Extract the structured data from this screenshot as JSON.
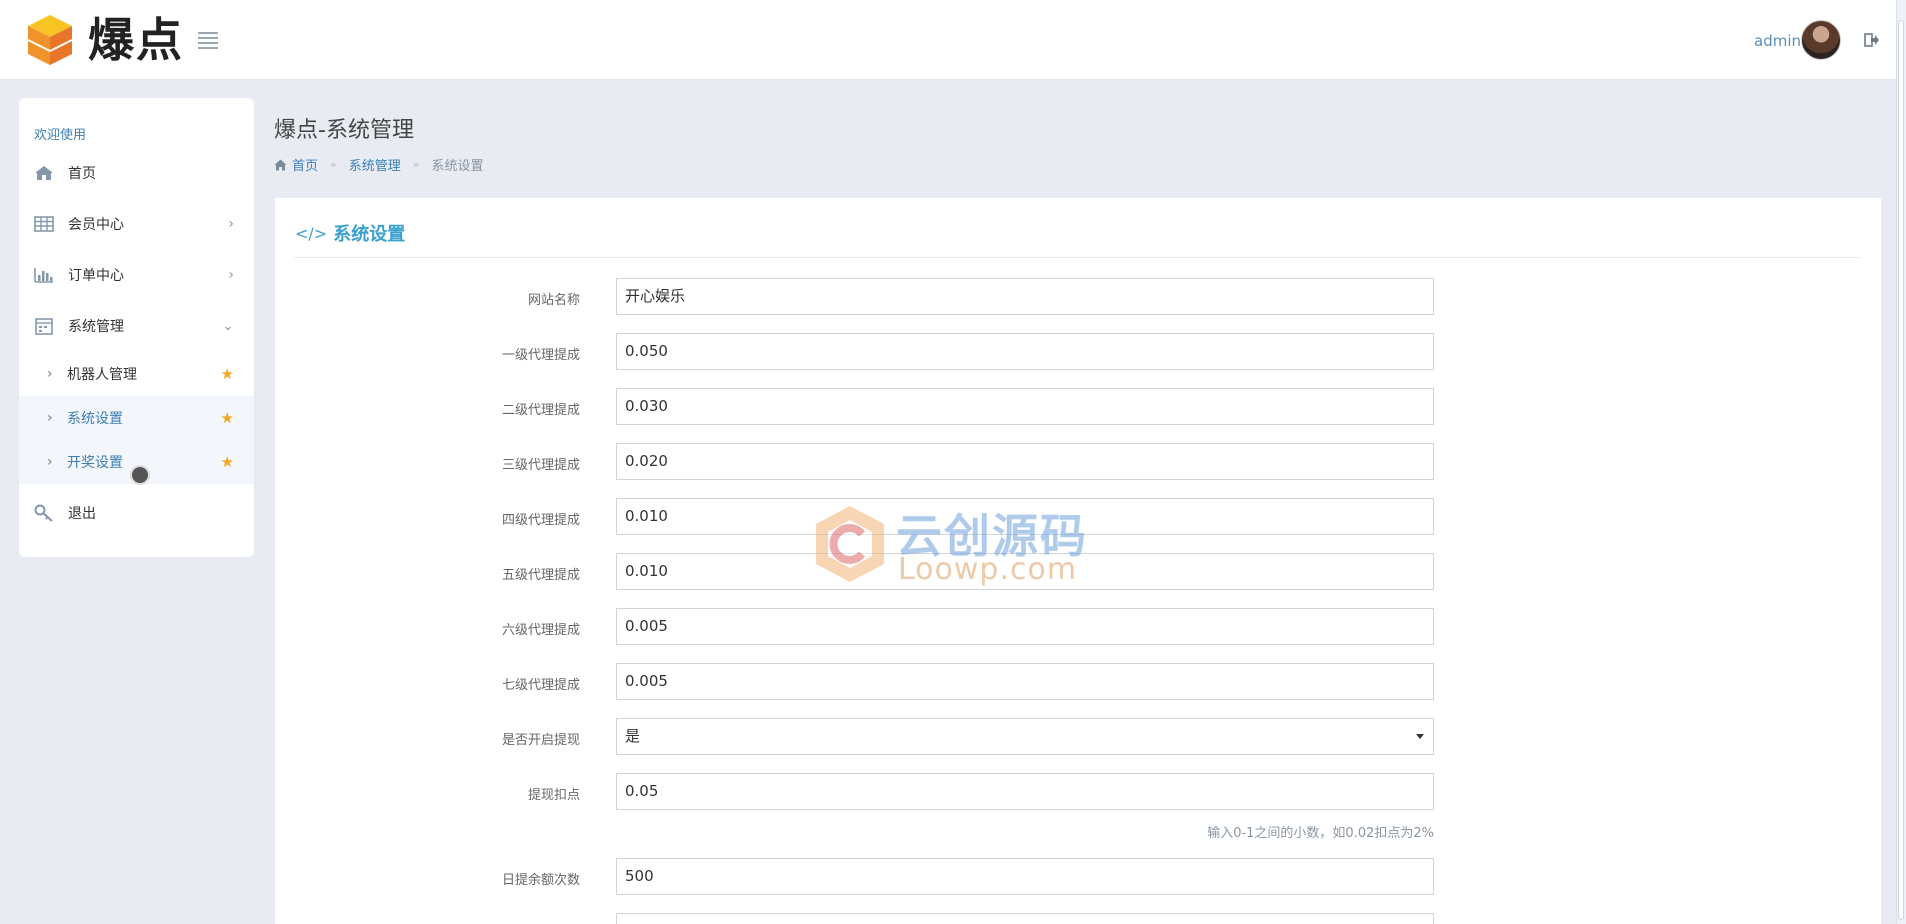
{
  "header": {
    "brand": "爆点",
    "user_name": "admin",
    "icons": {
      "logo": "cube-logo-icon",
      "menu": "list-icon",
      "logout": "logout-icon"
    }
  },
  "sidebar": {
    "welcome": "欢迎使用",
    "items": [
      {
        "label": "首页",
        "icon": "home-icon"
      },
      {
        "label": "会员中心",
        "icon": "table-icon",
        "chevron": "›"
      },
      {
        "label": "订单中心",
        "icon": "bar-chart-icon",
        "chevron": "›"
      },
      {
        "label": "系统管理",
        "icon": "calendar-icon",
        "chevron": "⌄"
      },
      {
        "label": "退出",
        "icon": "key-icon"
      }
    ],
    "subitems": [
      {
        "label": "机器人管理",
        "arrow": "›",
        "star": "★"
      },
      {
        "label": "系统设置",
        "arrow": "›",
        "star": "★"
      },
      {
        "label": "开奖设置",
        "arrow": "›",
        "star": "★"
      }
    ]
  },
  "page": {
    "title": "爆点-系统管理",
    "breadcrumb": {
      "home": "首页",
      "section": "系统管理",
      "current": "系统设置",
      "sep": "»"
    }
  },
  "panel": {
    "title": "系统设置",
    "title_icon": "</>"
  },
  "form": {
    "site_name": {
      "label": "网站名称",
      "value": "开心娱乐"
    },
    "level1": {
      "label": "一级代理提成",
      "value": "0.050"
    },
    "level2": {
      "label": "二级代理提成",
      "value": "0.030"
    },
    "level3": {
      "label": "三级代理提成",
      "value": "0.020"
    },
    "level4": {
      "label": "四级代理提成",
      "value": "0.010"
    },
    "level5": {
      "label": "五级代理提成",
      "value": "0.010"
    },
    "level6": {
      "label": "六级代理提成",
      "value": "0.005"
    },
    "level7": {
      "label": "七级代理提成",
      "value": "0.005"
    },
    "withdraw_enabled": {
      "label": "是否开启提现",
      "value": "是"
    },
    "withdraw_fee": {
      "label": "提现扣点",
      "value": "0.05",
      "hint": "输入0-1之间的小数，如0.02扣点为2%"
    },
    "daily_limit": {
      "label": "日提余额次数",
      "value": "500"
    }
  },
  "watermark": {
    "cn": "云创源码",
    "en": "Loowp.com"
  }
}
